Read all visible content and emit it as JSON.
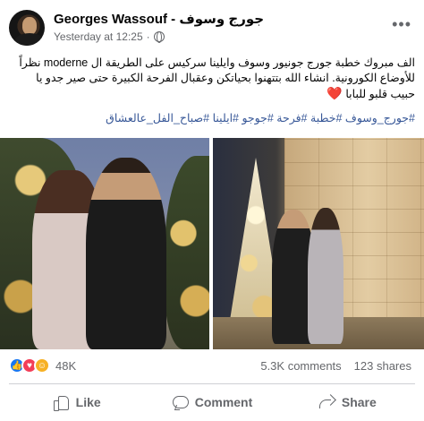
{
  "post": {
    "author": "Georges Wassouf - جورج وسوف",
    "timestamp": "Yesterday at 12:25",
    "separator": "·",
    "privacy_icon": "globe-icon",
    "more_label": "•••",
    "text": "الف مبروك خطبة جورج جونيور وسوف وايلينا سركيس على الطريقة ال moderne نظراً للأوضاع الكورونية. انشاء الله بتتهنوا بحياتكن وعقبال الفرحة الكبيرة حتى صير جدو يا حبيب قلبو للبابا",
    "heart": "❤️",
    "hashtags": "#جورج_وسوف #خطبة #فرحة #جوجو #ايلينا #صباح_الفل_عالعشاق"
  },
  "stats": {
    "reaction_icons": [
      "like-reaction-icon",
      "love-reaction-icon",
      "care-reaction-icon"
    ],
    "reactions_count": "48K",
    "comments": "5.3K comments",
    "shares": "123 shares"
  },
  "actions": {
    "like": "Like",
    "comment": "Comment",
    "share": "Share"
  },
  "colors": {
    "link": "#385898",
    "like_blue": "#1877f2",
    "secondary_text": "#65676b",
    "heart_red": "#e41e3f"
  }
}
